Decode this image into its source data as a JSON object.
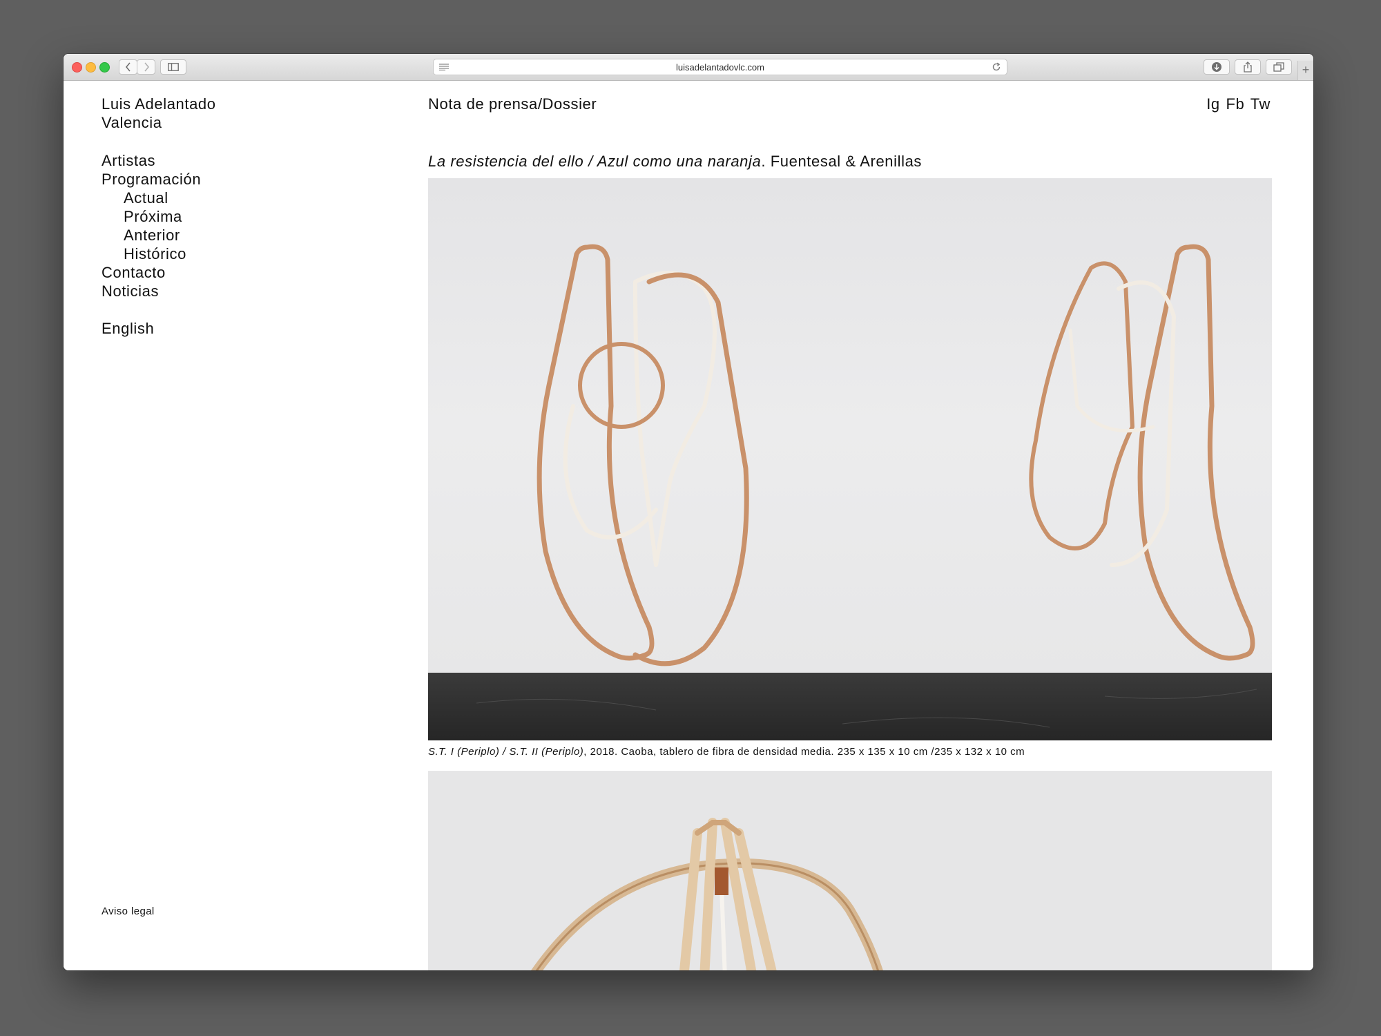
{
  "browser": {
    "url": "luisadelantadovlc.com",
    "icons": [
      "back-icon",
      "forward-icon",
      "sidebar-icon",
      "reader-icon",
      "reload-icon",
      "download-icon",
      "share-icon",
      "tabs-icon",
      "new-tab-icon"
    ]
  },
  "site": {
    "brand_line1": "Luis Adelantado",
    "brand_line2": "Valencia",
    "nav": {
      "artistas": "Artistas",
      "programacion": "Programación",
      "actual": "Actual",
      "proxima": "Próxima",
      "anterior": "Anterior",
      "historico": "Histórico",
      "contacto": "Contacto",
      "noticias": "Noticias"
    },
    "language": "English",
    "legal": "Aviso legal",
    "press_link": "Nota de prensa/Dossier",
    "social": {
      "ig": "Ig",
      "fb": "Fb",
      "tw": "Tw"
    }
  },
  "exhibition": {
    "title_italic": "La resistencia del ello / Azul como una naranja",
    "title_rest": ". Fuentesal & Arenillas",
    "caption_italic": "S.T. I (Periplo) / S.T. II (Periplo)",
    "caption_rest": ", 2018. Caoba, tablero de fibra de densidad media. 235 x 135 x 10 cm /235 x 132 x 10 cm"
  },
  "colors": {
    "background": "#5f5f5f",
    "page": "#ffffff",
    "text": "#111111",
    "wood": "#c9916a",
    "floor": "#2c2c2c"
  }
}
